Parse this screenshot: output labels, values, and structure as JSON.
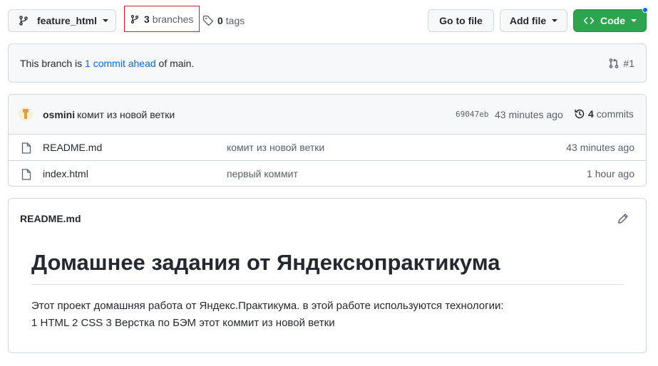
{
  "toolbar": {
    "branch_name": "feature_html",
    "branches_count": "3",
    "branches_label": "branches",
    "tags_count": "0",
    "tags_label": "tags",
    "go_to_file_label": "Go to file",
    "add_file_label": "Add file",
    "code_label": "Code"
  },
  "ahead": {
    "prefix": "This branch is",
    "link": "1 commit ahead",
    "suffix": "of main.",
    "pr_label": "#1"
  },
  "latest_commit": {
    "author": "osmini",
    "message": "комит из новой ветки",
    "sha": "69047eb",
    "time": "43 minutes ago",
    "commits_count": "4",
    "commits_label": "commits"
  },
  "files": [
    {
      "name": "README.md",
      "message": "комит из новой ветки",
      "time": "43 minutes ago"
    },
    {
      "name": "index.html",
      "message": "первый коммит",
      "time": "1 hour ago"
    }
  ],
  "readme": {
    "filename": "README.md",
    "heading": "Домашнее задания от Яндексюпрактикума",
    "line1": "Этот проект домашняя работа от Яндекс.Практикума. в этой работе используются технологии:",
    "line2": "1 HTML 2 CSS 3 Верстка по БЭМ этот коммит из новой ветки"
  },
  "colors": {
    "primary_button": "#2da44e",
    "link": "#0969da",
    "highlight_border": "#cf222e",
    "notification_dot": "#0969da"
  }
}
